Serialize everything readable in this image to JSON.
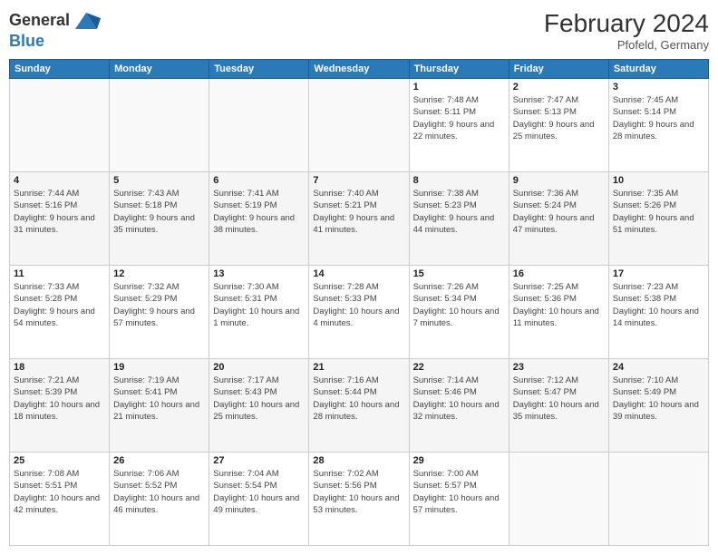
{
  "header": {
    "logo_line1": "General",
    "logo_line2": "Blue",
    "month_year": "February 2024",
    "location": "Pfofeld, Germany"
  },
  "weekdays": [
    "Sunday",
    "Monday",
    "Tuesday",
    "Wednesday",
    "Thursday",
    "Friday",
    "Saturday"
  ],
  "weeks": [
    [
      {
        "day": "",
        "info": ""
      },
      {
        "day": "",
        "info": ""
      },
      {
        "day": "",
        "info": ""
      },
      {
        "day": "",
        "info": ""
      },
      {
        "day": "1",
        "info": "Sunrise: 7:48 AM\nSunset: 5:11 PM\nDaylight: 9 hours and 22 minutes."
      },
      {
        "day": "2",
        "info": "Sunrise: 7:47 AM\nSunset: 5:13 PM\nDaylight: 9 hours and 25 minutes."
      },
      {
        "day": "3",
        "info": "Sunrise: 7:45 AM\nSunset: 5:14 PM\nDaylight: 9 hours and 28 minutes."
      }
    ],
    [
      {
        "day": "4",
        "info": "Sunrise: 7:44 AM\nSunset: 5:16 PM\nDaylight: 9 hours and 31 minutes."
      },
      {
        "day": "5",
        "info": "Sunrise: 7:43 AM\nSunset: 5:18 PM\nDaylight: 9 hours and 35 minutes."
      },
      {
        "day": "6",
        "info": "Sunrise: 7:41 AM\nSunset: 5:19 PM\nDaylight: 9 hours and 38 minutes."
      },
      {
        "day": "7",
        "info": "Sunrise: 7:40 AM\nSunset: 5:21 PM\nDaylight: 9 hours and 41 minutes."
      },
      {
        "day": "8",
        "info": "Sunrise: 7:38 AM\nSunset: 5:23 PM\nDaylight: 9 hours and 44 minutes."
      },
      {
        "day": "9",
        "info": "Sunrise: 7:36 AM\nSunset: 5:24 PM\nDaylight: 9 hours and 47 minutes."
      },
      {
        "day": "10",
        "info": "Sunrise: 7:35 AM\nSunset: 5:26 PM\nDaylight: 9 hours and 51 minutes."
      }
    ],
    [
      {
        "day": "11",
        "info": "Sunrise: 7:33 AM\nSunset: 5:28 PM\nDaylight: 9 hours and 54 minutes."
      },
      {
        "day": "12",
        "info": "Sunrise: 7:32 AM\nSunset: 5:29 PM\nDaylight: 9 hours and 57 minutes."
      },
      {
        "day": "13",
        "info": "Sunrise: 7:30 AM\nSunset: 5:31 PM\nDaylight: 10 hours and 1 minute."
      },
      {
        "day": "14",
        "info": "Sunrise: 7:28 AM\nSunset: 5:33 PM\nDaylight: 10 hours and 4 minutes."
      },
      {
        "day": "15",
        "info": "Sunrise: 7:26 AM\nSunset: 5:34 PM\nDaylight: 10 hours and 7 minutes."
      },
      {
        "day": "16",
        "info": "Sunrise: 7:25 AM\nSunset: 5:36 PM\nDaylight: 10 hours and 11 minutes."
      },
      {
        "day": "17",
        "info": "Sunrise: 7:23 AM\nSunset: 5:38 PM\nDaylight: 10 hours and 14 minutes."
      }
    ],
    [
      {
        "day": "18",
        "info": "Sunrise: 7:21 AM\nSunset: 5:39 PM\nDaylight: 10 hours and 18 minutes."
      },
      {
        "day": "19",
        "info": "Sunrise: 7:19 AM\nSunset: 5:41 PM\nDaylight: 10 hours and 21 minutes."
      },
      {
        "day": "20",
        "info": "Sunrise: 7:17 AM\nSunset: 5:43 PM\nDaylight: 10 hours and 25 minutes."
      },
      {
        "day": "21",
        "info": "Sunrise: 7:16 AM\nSunset: 5:44 PM\nDaylight: 10 hours and 28 minutes."
      },
      {
        "day": "22",
        "info": "Sunrise: 7:14 AM\nSunset: 5:46 PM\nDaylight: 10 hours and 32 minutes."
      },
      {
        "day": "23",
        "info": "Sunrise: 7:12 AM\nSunset: 5:47 PM\nDaylight: 10 hours and 35 minutes."
      },
      {
        "day": "24",
        "info": "Sunrise: 7:10 AM\nSunset: 5:49 PM\nDaylight: 10 hours and 39 minutes."
      }
    ],
    [
      {
        "day": "25",
        "info": "Sunrise: 7:08 AM\nSunset: 5:51 PM\nDaylight: 10 hours and 42 minutes."
      },
      {
        "day": "26",
        "info": "Sunrise: 7:06 AM\nSunset: 5:52 PM\nDaylight: 10 hours and 46 minutes."
      },
      {
        "day": "27",
        "info": "Sunrise: 7:04 AM\nSunset: 5:54 PM\nDaylight: 10 hours and 49 minutes."
      },
      {
        "day": "28",
        "info": "Sunrise: 7:02 AM\nSunset: 5:56 PM\nDaylight: 10 hours and 53 minutes."
      },
      {
        "day": "29",
        "info": "Sunrise: 7:00 AM\nSunset: 5:57 PM\nDaylight: 10 hours and 57 minutes."
      },
      {
        "day": "",
        "info": ""
      },
      {
        "day": "",
        "info": ""
      }
    ]
  ]
}
